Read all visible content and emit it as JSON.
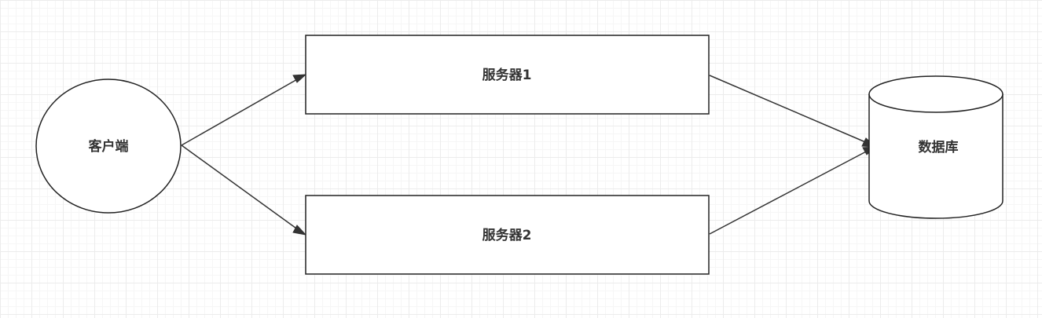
{
  "diagram": {
    "nodes": {
      "client": {
        "label": "客户端",
        "shape": "ellipse"
      },
      "server1": {
        "label": "服务器1",
        "shape": "rectangle"
      },
      "server2": {
        "label": "服务器2",
        "shape": "rectangle"
      },
      "database": {
        "label": "数据库",
        "shape": "cylinder"
      }
    },
    "edges": [
      {
        "from": "client",
        "to": "server1"
      },
      {
        "from": "client",
        "to": "server2"
      },
      {
        "from": "server1",
        "to": "database"
      },
      {
        "from": "server2",
        "to": "database"
      }
    ],
    "colors": {
      "background": "#ffffff",
      "grid": "#ececec",
      "stroke": "#222222",
      "text": "#333333"
    }
  }
}
